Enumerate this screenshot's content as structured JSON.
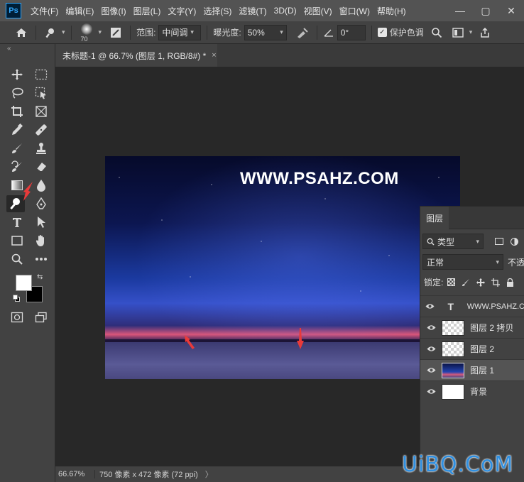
{
  "app": {
    "logo": "Ps"
  },
  "menu": [
    "文件(F)",
    "编辑(E)",
    "图像(I)",
    "图层(L)",
    "文字(Y)",
    "选择(S)",
    "滤镜(T)",
    "3D(D)",
    "视图(V)",
    "窗口(W)",
    "帮助(H)"
  ],
  "window_controls": {
    "minimize": "—",
    "maximize": "▢",
    "close": "✕"
  },
  "options": {
    "brush_size": "70",
    "range_label": "范围:",
    "range_value": "中间调",
    "exposure_label": "曝光度:",
    "exposure_value": "50%",
    "angle_value": "0°",
    "protect_tones_label": "保护色调",
    "protect_tones_checked": true
  },
  "toolbar": {
    "collapse": "«"
  },
  "document": {
    "tab_title": "未标题-1 @ 66.7% (图层 1, RGB/8#) *",
    "tab_close": "×",
    "canvas_text": "WWW.PSAHZ.COM"
  },
  "status": {
    "zoom": "66.67%",
    "info": "750 像素 x 472 像素 (72 ppi)",
    "chevron": "〉"
  },
  "layers_panel": {
    "tab": "图层",
    "filter_kind": "类型",
    "blend_mode": "正常",
    "opacity_label": "不透",
    "lock_label": "锁定:",
    "layers": [
      {
        "name": "WWW.PSAHZ.C",
        "kind": "type",
        "selected": false
      },
      {
        "name": "图层 2 拷贝",
        "kind": "checker",
        "selected": false
      },
      {
        "name": "图层 2",
        "kind": "checker",
        "selected": false
      },
      {
        "name": "图层 1",
        "kind": "photo",
        "selected": true
      },
      {
        "name": "背景",
        "kind": "white",
        "selected": false
      }
    ]
  },
  "colors": {
    "foreground": "#ffffff",
    "background": "#000000",
    "accent": "#31a8ff",
    "annotation_arrow": "#e83a3a"
  },
  "watermark": "UiBQ.CoM"
}
